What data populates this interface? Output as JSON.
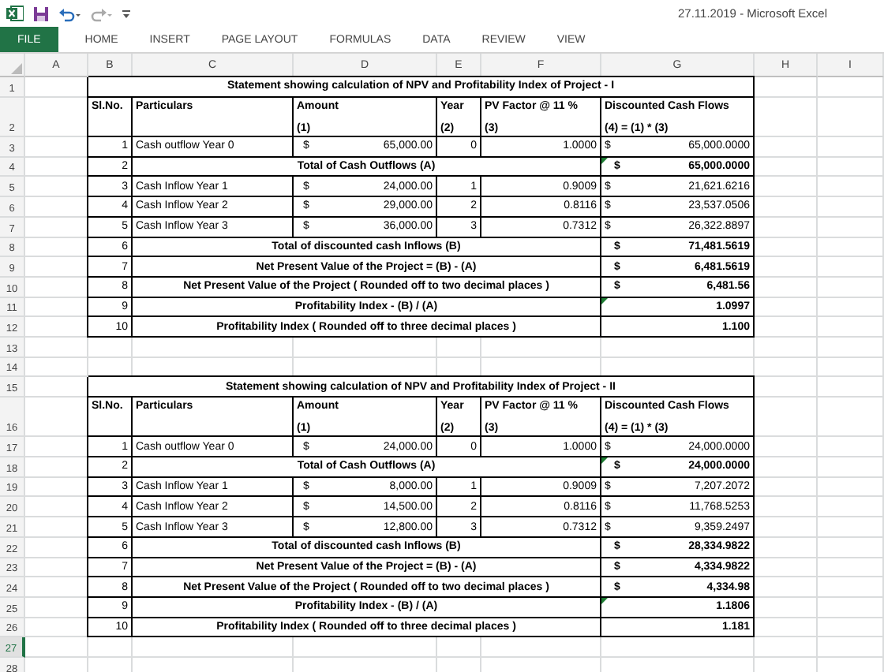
{
  "title_bar": {
    "title": "27.11.2019 - Microsoft Excel"
  },
  "ribbon_tabs": [
    {
      "label": "FILE",
      "kind": "file"
    },
    {
      "label": "HOME",
      "kind": "tab"
    },
    {
      "label": "INSERT",
      "kind": "tab"
    },
    {
      "label": "PAGE LAYOUT",
      "kind": "tab"
    },
    {
      "label": "FORMULAS",
      "kind": "tab"
    },
    {
      "label": "DATA",
      "kind": "tab"
    },
    {
      "label": "REVIEW",
      "kind": "tab"
    },
    {
      "label": "VIEW",
      "kind": "tab"
    }
  ],
  "columns": [
    "A",
    "B",
    "C",
    "D",
    "E",
    "F",
    "G",
    "H",
    "I"
  ],
  "rows": [
    {
      "number": "1",
      "selected": false,
      "kind": "title",
      "text": "Statement showing calculation of NPV and Profitability Index of Project - I"
    },
    {
      "number": "2",
      "selected": false,
      "kind": "header",
      "cells": [
        [
          "Sl.No."
        ],
        [
          "Particulars"
        ],
        [
          "Amount",
          "(1)"
        ],
        [
          "Year",
          "(2)"
        ],
        [
          "PV Factor @ 11 %",
          "(3)"
        ],
        [
          "Discounted Cash Flows",
          "(4) = (1) * (3)"
        ]
      ]
    },
    {
      "number": "3",
      "selected": false,
      "kind": "item",
      "sl": "1",
      "particulars": "Cash outflow Year 0",
      "amount_currency": "$",
      "amount": "65,000.00",
      "year": "0",
      "factor": "1.0000",
      "value_currency": "$",
      "value": "65,000.0000"
    },
    {
      "number": "4",
      "selected": false,
      "kind": "summary",
      "sl": "2",
      "label": "Total of Cash Outflows (A)",
      "value_currency": "$",
      "value": "65,000.0000",
      "flagged": true
    },
    {
      "number": "5",
      "selected": false,
      "kind": "item",
      "sl": "3",
      "particulars": "Cash Inflow Year 1",
      "amount_currency": "$",
      "amount": "24,000.00",
      "year": "1",
      "factor": "0.9009",
      "value_currency": "$",
      "value": "21,621.6216"
    },
    {
      "number": "6",
      "selected": false,
      "kind": "item",
      "sl": "4",
      "particulars": "Cash Inflow Year 2",
      "amount_currency": "$",
      "amount": "29,000.00",
      "year": "2",
      "factor": "0.8116",
      "value_currency": "$",
      "value": "23,537.0506"
    },
    {
      "number": "7",
      "selected": false,
      "kind": "item",
      "sl": "5",
      "particulars": "Cash Inflow Year 3",
      "amount_currency": "$",
      "amount": "36,000.00",
      "year": "3",
      "factor": "0.7312",
      "value_currency": "$",
      "value": "26,322.8897"
    },
    {
      "number": "8",
      "selected": false,
      "kind": "summary",
      "sl": "6",
      "label": "Total of discounted cash Inflows (B)",
      "value_currency": "$",
      "value": "71,481.5619",
      "flagged": false
    },
    {
      "number": "9",
      "selected": false,
      "kind": "summary",
      "sl": "7",
      "label": "Net Present Value of the Project = (B) - (A)",
      "value_currency": "$",
      "value": "6,481.5619",
      "flagged": false
    },
    {
      "number": "10",
      "selected": false,
      "kind": "summary",
      "sl": "8",
      "label": "Net Present Value of the Project ( Rounded off to two decimal places )",
      "value_currency": "$",
      "value": "6,481.56",
      "flagged": false
    },
    {
      "number": "11",
      "selected": false,
      "kind": "summary",
      "sl": "9",
      "label": "Profitability Index  - (B) / (A)",
      "value": "1.0997",
      "flagged": true
    },
    {
      "number": "12",
      "selected": false,
      "kind": "summary",
      "sl": "10",
      "label": "Profitability Index ( Rounded off to three decimal places )",
      "value": "1.100",
      "flagged": false
    },
    {
      "number": "13",
      "selected": false,
      "kind": "blank"
    },
    {
      "number": "14",
      "selected": false,
      "kind": "blank"
    },
    {
      "number": "15",
      "selected": false,
      "kind": "title",
      "text": "Statement showing calculation of NPV and Profitability Index of Project - II"
    },
    {
      "number": "16",
      "selected": false,
      "kind": "header",
      "cells": [
        [
          "Sl.No."
        ],
        [
          "Particulars"
        ],
        [
          "Amount",
          "(1)"
        ],
        [
          "Year",
          "(2)"
        ],
        [
          "PV Factor @ 11 %",
          "(3)"
        ],
        [
          "Discounted Cash Flows",
          "(4) = (1) * (3)"
        ]
      ]
    },
    {
      "number": "17",
      "selected": false,
      "kind": "item",
      "sl": "1",
      "particulars": "Cash outflow Year 0",
      "amount_currency": "$",
      "amount": "24,000.00",
      "year": "0",
      "factor": "1.0000",
      "value_currency": "$",
      "value": "24,000.0000"
    },
    {
      "number": "18",
      "selected": false,
      "kind": "summary",
      "sl": "2",
      "label": "Total of Cash Outflows (A)",
      "value_currency": "$",
      "value": "24,000.0000",
      "flagged": true
    },
    {
      "number": "19",
      "selected": false,
      "kind": "item",
      "sl": "3",
      "particulars": "Cash Inflow Year 1",
      "amount_currency": "$",
      "amount": "8,000.00",
      "year": "1",
      "factor": "0.9009",
      "value_currency": "$",
      "value": "7,207.2072"
    },
    {
      "number": "20",
      "selected": false,
      "kind": "item",
      "sl": "4",
      "particulars": "Cash Inflow Year 2",
      "amount_currency": "$",
      "amount": "14,500.00",
      "year": "2",
      "factor": "0.8116",
      "value_currency": "$",
      "value": "11,768.5253"
    },
    {
      "number": "21",
      "selected": false,
      "kind": "item",
      "sl": "5",
      "particulars": "Cash Inflow Year 3",
      "amount_currency": "$",
      "amount": "12,800.00",
      "year": "3",
      "factor": "0.7312",
      "value_currency": "$",
      "value": "9,359.2497"
    },
    {
      "number": "22",
      "selected": false,
      "kind": "summary",
      "sl": "6",
      "label": "Total of discounted cash Inflows (B)",
      "value_currency": "$",
      "value": "28,334.9822",
      "flagged": false
    },
    {
      "number": "23",
      "selected": false,
      "kind": "summary",
      "sl": "7",
      "label": "Net Present Value of the Project = (B) - (A)",
      "value_currency": "$",
      "value": "4,334.9822",
      "flagged": false
    },
    {
      "number": "24",
      "selected": false,
      "kind": "summary",
      "sl": "8",
      "label": "Net Present Value of the Project ( Rounded off to two decimal places )",
      "value_currency": "$",
      "value": "4,334.98",
      "flagged": false
    },
    {
      "number": "25",
      "selected": false,
      "kind": "summary",
      "sl": "9",
      "label": "Profitability Index  - (B) / (A)",
      "value": "1.1806",
      "flagged": true
    },
    {
      "number": "26",
      "selected": false,
      "kind": "summary",
      "sl": "10",
      "label": "Profitability Index ( Rounded off to three decimal places )",
      "value": "1.181",
      "flagged": false
    },
    {
      "number": "27",
      "selected": true,
      "kind": "blank"
    },
    {
      "number": "28",
      "selected": false,
      "kind": "blank"
    }
  ]
}
